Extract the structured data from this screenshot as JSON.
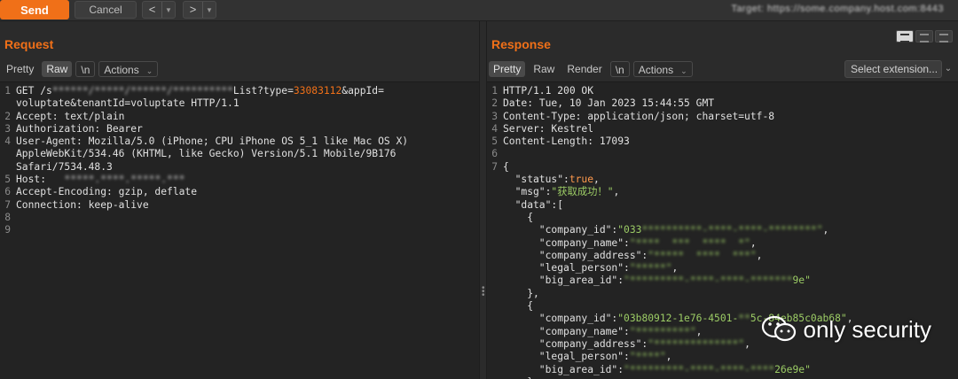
{
  "toolbar": {
    "send_label": "Send",
    "cancel_label": "Cancel",
    "back_glyph": "<",
    "forward_glyph": ">",
    "target_text": "Target: https://some.company.host.com:8443"
  },
  "request": {
    "title": "Request",
    "tabs": [
      "Pretty",
      "Raw",
      "\\n",
      "Actions"
    ],
    "active_tab": "Raw",
    "lines": [
      {
        "n": "1",
        "parts": [
          [
            "p",
            "GET /s"
          ],
          [
            "r",
            "******/*****/******/**********"
          ],
          [
            "p",
            "List?type="
          ],
          [
            "h",
            "33083112"
          ],
          [
            "p",
            "&appId="
          ]
        ]
      },
      {
        "n": "",
        "parts": [
          [
            "p",
            "voluptate&tenantId=voluptate HTTP/1.1"
          ]
        ]
      },
      {
        "n": "2",
        "parts": [
          [
            "p",
            "Accept: text/plain"
          ]
        ]
      },
      {
        "n": "3",
        "parts": [
          [
            "p",
            "Authorization: Bearer"
          ]
        ]
      },
      {
        "n": "4",
        "parts": [
          [
            "p",
            "User-Agent: Mozilla/5.0 (iPhone; CPU iPhone OS 5_1 like Mac OS X)"
          ]
        ]
      },
      {
        "n": "",
        "parts": [
          [
            "p",
            "AppleWebKit/534.46 (KHTML, like Gecko) Version/5.1 Mobile/9B176"
          ]
        ]
      },
      {
        "n": "",
        "parts": [
          [
            "p",
            "Safari/7534.48.3"
          ]
        ]
      },
      {
        "n": "5",
        "parts": [
          [
            "p",
            "Host:   "
          ],
          [
            "r",
            "*****.****.*****.***"
          ]
        ]
      },
      {
        "n": "6",
        "parts": [
          [
            "p",
            "Accept-Encoding: gzip, deflate"
          ]
        ]
      },
      {
        "n": "7",
        "parts": [
          [
            "p",
            "Connection: keep-alive"
          ]
        ]
      },
      {
        "n": "8",
        "parts": [
          [
            "p",
            ""
          ]
        ]
      },
      {
        "n": "9",
        "parts": [
          [
            "p",
            ""
          ]
        ]
      }
    ]
  },
  "response": {
    "title": "Response",
    "tabs": [
      "Pretty",
      "Raw",
      "Render",
      "\\n",
      "Actions"
    ],
    "active_tab": "Pretty",
    "select_extension": "Select extension...",
    "lines": [
      {
        "n": "1",
        "parts": [
          [
            "p",
            "HTTP/1.1 200 OK"
          ]
        ]
      },
      {
        "n": "2",
        "parts": [
          [
            "p",
            "Date: Tue, 10 Jan 2023 15:44:55 GMT"
          ]
        ]
      },
      {
        "n": "3",
        "parts": [
          [
            "p",
            "Content-Type: application/json; charset=utf-8"
          ]
        ]
      },
      {
        "n": "4",
        "parts": [
          [
            "p",
            "Server: Kestrel"
          ]
        ]
      },
      {
        "n": "5",
        "parts": [
          [
            "p",
            "Content-Length: 17093"
          ]
        ]
      },
      {
        "n": "6",
        "parts": [
          [
            "p",
            ""
          ]
        ]
      },
      {
        "n": "7",
        "parts": [
          [
            "p",
            "{"
          ]
        ]
      },
      {
        "n": "",
        "parts": [
          [
            "p",
            "  \"status\":"
          ],
          [
            "b",
            "true"
          ],
          [
            "p",
            ","
          ]
        ]
      },
      {
        "n": "",
        "parts": [
          [
            "p",
            "  \"msg\":"
          ],
          [
            "s",
            "\"获取成功！\""
          ],
          [
            "p",
            ","
          ]
        ]
      },
      {
        "n": "",
        "parts": [
          [
            "p",
            "  \"data\":["
          ]
        ]
      },
      {
        "n": "",
        "parts": [
          [
            "p",
            "    {"
          ]
        ]
      },
      {
        "n": "",
        "parts": [
          [
            "p",
            "      \"company_id\":"
          ],
          [
            "s",
            "\"033"
          ],
          [
            "g",
            "**********-****-****-********\""
          ],
          [
            "p",
            ","
          ]
        ]
      },
      {
        "n": "",
        "parts": [
          [
            "p",
            "      \"company_name\":"
          ],
          [
            "g",
            "\"****  ***  ****  *\""
          ],
          [
            "p",
            ","
          ]
        ]
      },
      {
        "n": "",
        "parts": [
          [
            "p",
            "      \"company_address\":"
          ],
          [
            "g",
            "\"*****  ****  ***\""
          ],
          [
            "p",
            ","
          ]
        ]
      },
      {
        "n": "",
        "parts": [
          [
            "p",
            "      \"legal_person\":"
          ],
          [
            "g",
            "\"*****\""
          ],
          [
            "p",
            ","
          ]
        ]
      },
      {
        "n": "",
        "parts": [
          [
            "p",
            "      \"big_area_id\":"
          ],
          [
            "g",
            "\"*********-****-****-*******"
          ],
          [
            "s",
            "9e\""
          ]
        ]
      },
      {
        "n": "",
        "parts": [
          [
            "p",
            "    },"
          ]
        ]
      },
      {
        "n": "",
        "parts": [
          [
            "p",
            "    {"
          ]
        ]
      },
      {
        "n": "",
        "parts": [
          [
            "p",
            "      \"company_id\":"
          ],
          [
            "s",
            "\"03b80912-1e76-4501-"
          ],
          [
            "g",
            "**"
          ],
          [
            "s",
            "5c-84eb85c0ab68\""
          ],
          [
            "p",
            ","
          ]
        ]
      },
      {
        "n": "",
        "parts": [
          [
            "p",
            "      \"company_name\":"
          ],
          [
            "g",
            "\"*********\""
          ],
          [
            "p",
            ","
          ]
        ]
      },
      {
        "n": "",
        "parts": [
          [
            "p",
            "      \"company_address\":"
          ],
          [
            "g",
            "\"**************\""
          ],
          [
            "p",
            ","
          ]
        ]
      },
      {
        "n": "",
        "parts": [
          [
            "p",
            "      \"legal_person\":"
          ],
          [
            "g",
            "\"****\""
          ],
          [
            "p",
            ","
          ]
        ]
      },
      {
        "n": "",
        "parts": [
          [
            "p",
            "      \"big_area_id\":"
          ],
          [
            "g",
            "\"*********-****-****-****"
          ],
          [
            "s",
            "26e9e\""
          ]
        ]
      },
      {
        "n": "",
        "parts": [
          [
            "p",
            "    }"
          ]
        ]
      }
    ]
  },
  "watermark": {
    "text": "only security",
    "icon": "wechat-icon"
  },
  "colors": {
    "accent": "#f07018",
    "string": "#9ccc65",
    "boolean": "#ff9a4d"
  }
}
